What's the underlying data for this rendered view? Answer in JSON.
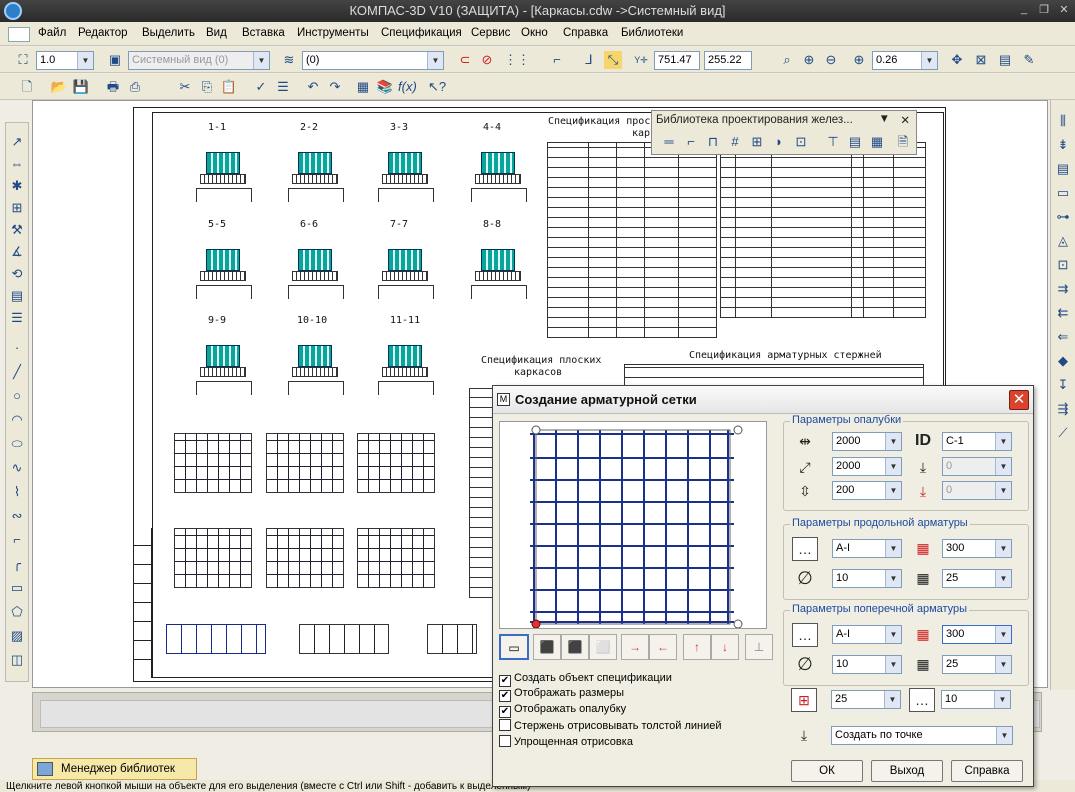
{
  "window": {
    "title": "КОМПАС-3D V10 (ЗАЩИТА) - [Каркасы.cdw ->Системный вид]"
  },
  "menu": [
    "Файл",
    "Редактор",
    "Выделить",
    "Вид",
    "Вставка",
    "Инструменты",
    "Спецификация",
    "Сервис",
    "Окно",
    "Справка",
    "Библиотеки"
  ],
  "toolbar1": {
    "scale": "1.0",
    "view": "Системный вид (0)",
    "layer": "(0)",
    "coord_x": "751.47",
    "coord_y": "255.22",
    "zoom": "0.26"
  },
  "drawing": {
    "sections_row1": [
      "1-1",
      "2-2",
      "3-3",
      "4-4"
    ],
    "sections_row2": [
      "5-5",
      "6-6",
      "7-7",
      "8-8"
    ],
    "sections_row3": [
      "9-9",
      "10-10",
      "11-11"
    ],
    "spec_title_1": "Спецификация просто",
    "spec_title_1b": "каркасов",
    "spec_title_2": "Спецификация плоских",
    "spec_title_2b": "каркасов",
    "spec_title_3": "Спецификация арматурных стержней"
  },
  "libpanel": {
    "title": "Библиотека проектирования желез..."
  },
  "dialog": {
    "title": "Создание арматурной сетки",
    "group_formwork": {
      "title": "Параметры опалубки",
      "width": "2000",
      "length": "2000",
      "thickness": "200",
      "id_label": "ID",
      "id_value": "С-1",
      "val2": "0",
      "val3": "0"
    },
    "group_long": {
      "title": "Параметры продольной арматуры",
      "class": "A-I",
      "step": "300",
      "diameter": "10",
      "count": "25"
    },
    "group_trans": {
      "title": "Параметры поперечной арматуры",
      "class": "A-I",
      "step": "300",
      "diameter": "10",
      "count": "25"
    },
    "extra": {
      "cover": "25",
      "offset": "10",
      "mode": "Создать по точке"
    },
    "checks": [
      {
        "label": "Создать объект спецификации",
        "checked": true
      },
      {
        "label": "Отображать размеры",
        "checked": true
      },
      {
        "label": "Отображать опалубку",
        "checked": true
      },
      {
        "label": "Стержень отрисовывать толстой линией",
        "checked": false
      },
      {
        "label": "Упрощенная отрисовка",
        "checked": false
      }
    ],
    "buttons": {
      "ok": "ОК",
      "exit": "Выход",
      "help": "Справка"
    }
  },
  "library_manager": "Менеджер библиотек",
  "status": "Щелкните левой кнопкой мыши на объекте для его выделения (вместе с Ctrl или Shift - добавить к выделенным)"
}
